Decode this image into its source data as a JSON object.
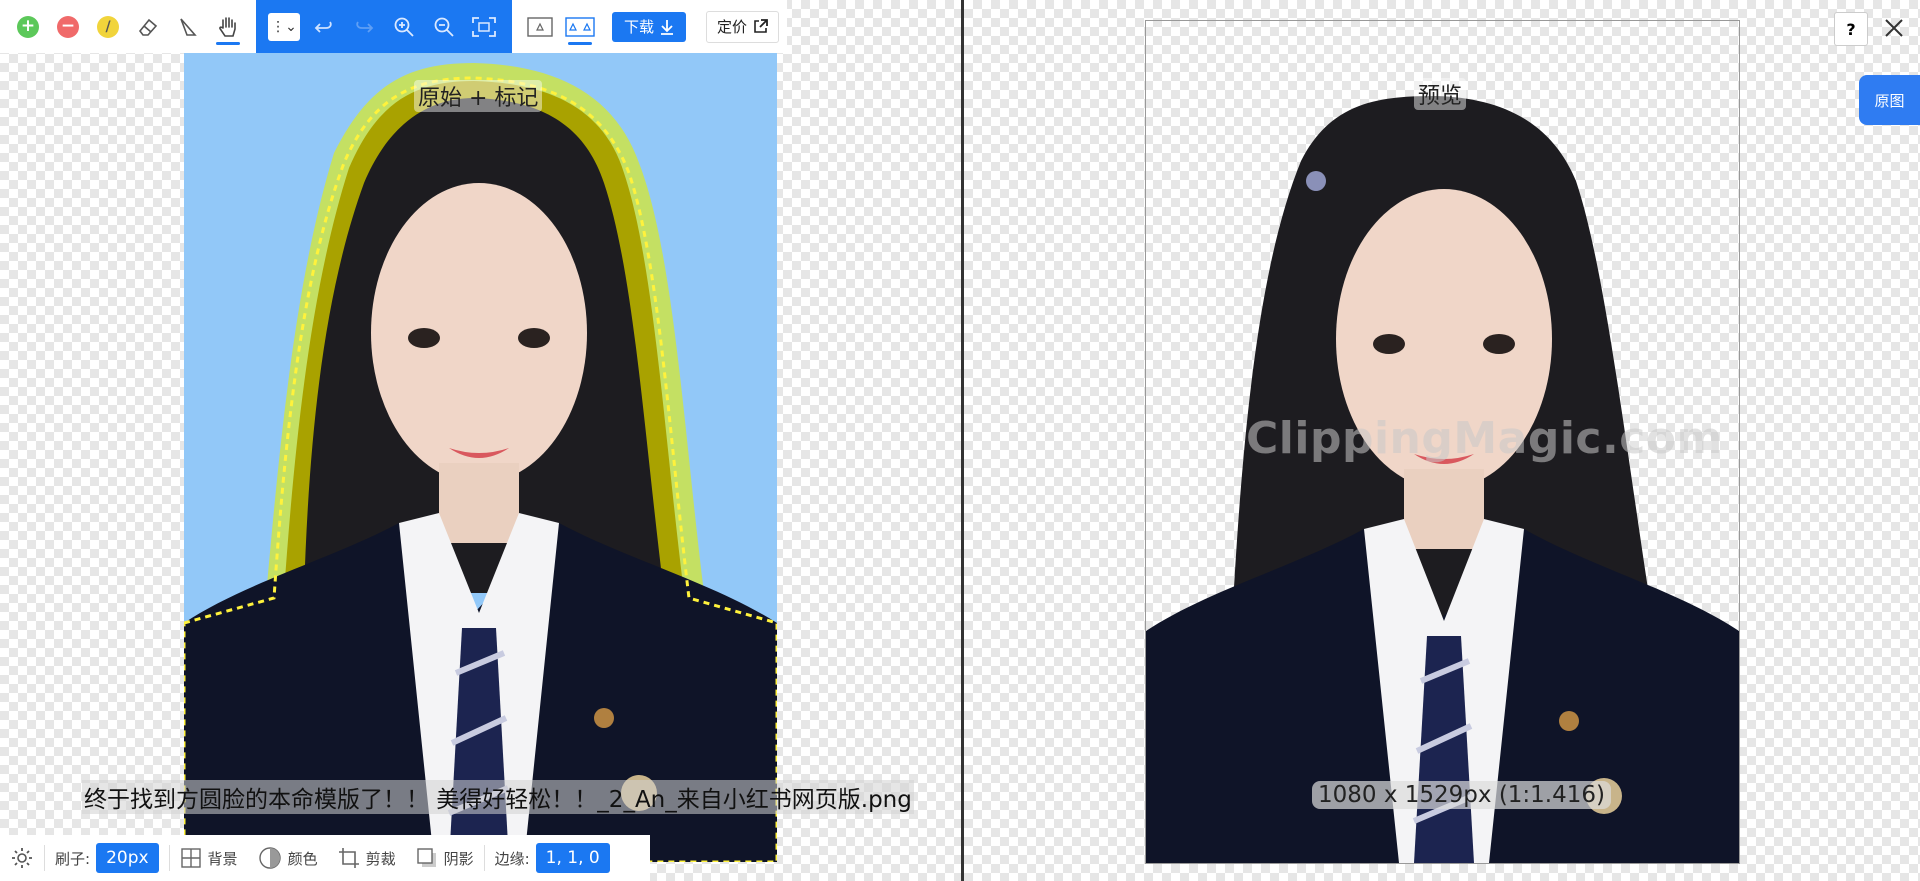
{
  "toolbar": {
    "tools": [
      {
        "name": "add-keep-tool",
        "icon": "plus-circle-icon",
        "color": "#5cc85a"
      },
      {
        "name": "remove-tool",
        "icon": "minus-circle-icon",
        "color": "#f06a6a"
      },
      {
        "name": "hair-tool",
        "icon": "slash-circle-icon",
        "color": "#f1d43b"
      },
      {
        "name": "eraser-tool",
        "icon": "eraser-icon"
      },
      {
        "name": "scalpel-tool",
        "icon": "scalpel-icon"
      },
      {
        "name": "pan-tool",
        "icon": "hand-icon",
        "active": true
      }
    ],
    "blue_tools": [
      {
        "name": "more-menu",
        "icon": "more-dropdown-icon"
      },
      {
        "name": "undo",
        "icon": "undo-icon"
      },
      {
        "name": "redo",
        "icon": "redo-icon",
        "disabled": true
      },
      {
        "name": "zoom-in",
        "icon": "zoom-in-icon"
      },
      {
        "name": "zoom-out",
        "icon": "zoom-out-icon"
      },
      {
        "name": "fit",
        "icon": "fit-screen-icon"
      }
    ],
    "view_modes": [
      {
        "name": "single-view",
        "icon": "single-view-icon"
      },
      {
        "name": "split-view",
        "icon": "split-view-icon",
        "active": true
      }
    ],
    "download_label": "下载",
    "pricing_label": "定价"
  },
  "left_pane": {
    "label": "原始 + 标记",
    "filename": "终于找到方圆脸的本命模版了！！ 美得好轻松！！_2_An_来自小红书网页版.png"
  },
  "right_pane": {
    "label": "预览",
    "dimensions": "1080 x 1529px (1:1.416)",
    "watermark": "ClippingMagic.com"
  },
  "bottom_bar": {
    "brush_label": "刷子:",
    "brush_value": "20px",
    "background_label": "背景",
    "color_label": "颜色",
    "crop_label": "剪裁",
    "shadow_label": "阴影",
    "margin_label": "边缘:",
    "margin_value": "1, 1, 0"
  },
  "top_right": {
    "help_label": "?",
    "original_tab_label": "原图"
  },
  "colors": {
    "accent": "#1b78f2",
    "mask_fg": "#a9a200",
    "mask_bg": "#c4e063",
    "photo_bg": "#92c8f8"
  }
}
